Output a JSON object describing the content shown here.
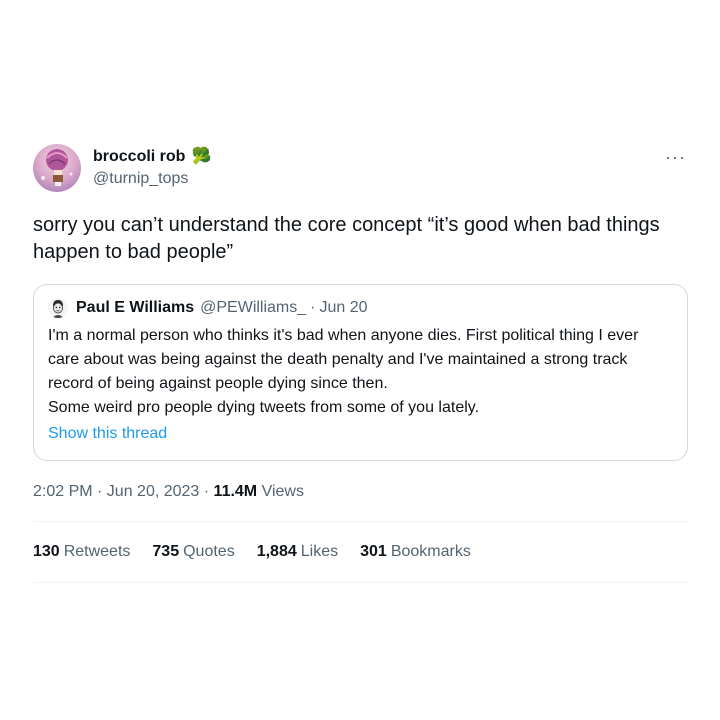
{
  "author": {
    "display_name": "broccoli rob",
    "emoji": "🥦",
    "handle": "@turnip_tops"
  },
  "more_menu": "···",
  "tweet_text": "sorry you can’t understand the core concept “it’s good when bad things happen to bad people”",
  "quote": {
    "display_name": "Paul E Williams",
    "handle": "@PEWilliams_",
    "separator": "·",
    "date": "Jun 20",
    "text": "I'm a normal person who thinks it's bad when anyone dies. First political thing I ever care about was being against the death penalty and I've maintained a strong track record of being against people dying since then.\nSome weird pro people dying tweets from some of you lately.",
    "show_thread": "Show this thread"
  },
  "meta": {
    "timestamp": "2:02 PM · Jun 20, 2023 · ",
    "views_count": "11.4M",
    "views_label": " Views"
  },
  "stats": [
    {
      "count": "130",
      "label": "Retweets"
    },
    {
      "count": "735",
      "label": "Quotes"
    },
    {
      "count": "1,884",
      "label": "Likes"
    },
    {
      "count": "301",
      "label": "Bookmarks"
    }
  ],
  "colors": {
    "text": "#0f1419",
    "secondary": "#536471",
    "link": "#1d9bf0",
    "border": "#cfd9de"
  }
}
